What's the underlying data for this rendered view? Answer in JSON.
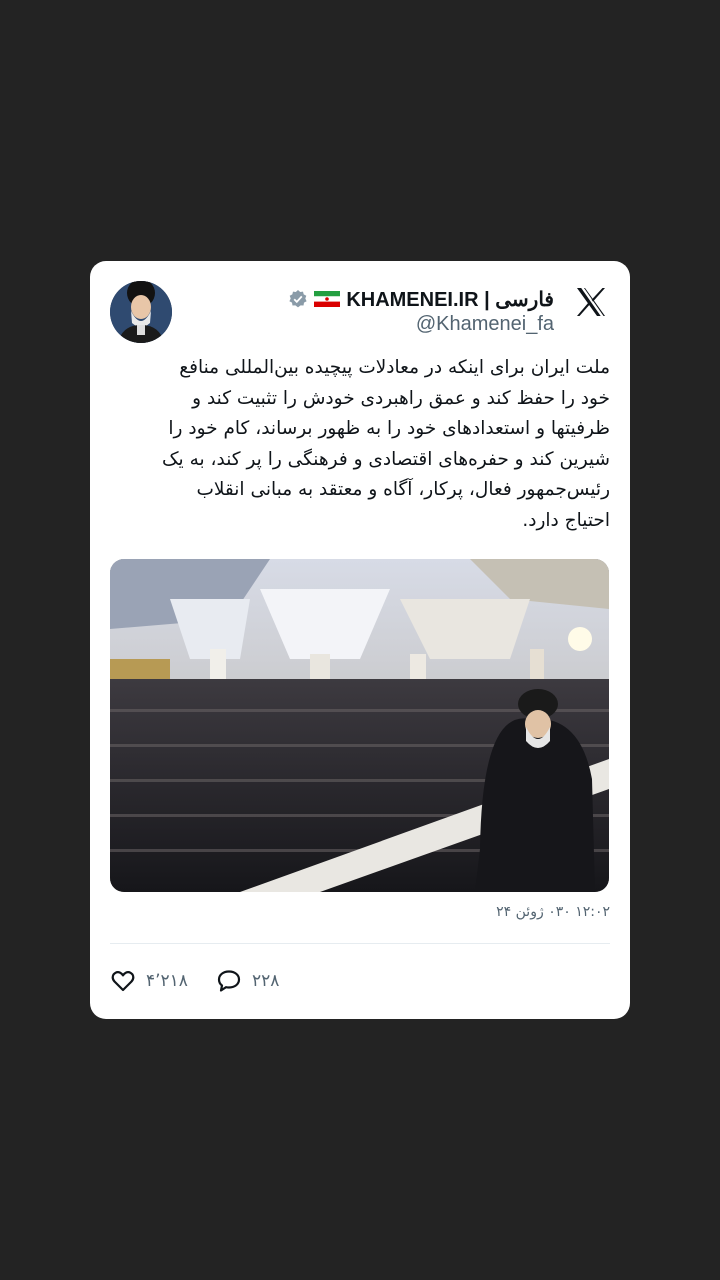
{
  "tweet": {
    "display_name": "KHAMENEI.IR | فارسی",
    "handle": "@Khamenei_fa",
    "flag_emoji": "iran-flag-icon",
    "verified_color": "#8a9ba8",
    "lines": [
      "ملت ایران برای اینکه در معادلات پیچیده بین‌المللی منافع",
      "خود را حفظ کند و عمق راهبردی خودش را تثبیت کند و",
      "ظرفیتها و استعدادهای خود را به ظهور برساند، کام خود را",
      "شیرین کند و حفره‌های اقتصادی و فرهنگی را پر کند، به یک",
      "رئیس‌جمهور فعال، پرکار، آگاه و معتقد به مبانی انقلاب",
      "احتیاج دارد."
    ],
    "timestamp": "۱۲:۰۲ ۰۳۰ ژوئن ۲۴"
  },
  "actions": {
    "likes": "۴٬۲۱۸",
    "replies": "۲۲۸"
  },
  "colors": {
    "background": "#232323",
    "card": "#ffffff",
    "text": "#0f1419",
    "muted": "#536471"
  }
}
